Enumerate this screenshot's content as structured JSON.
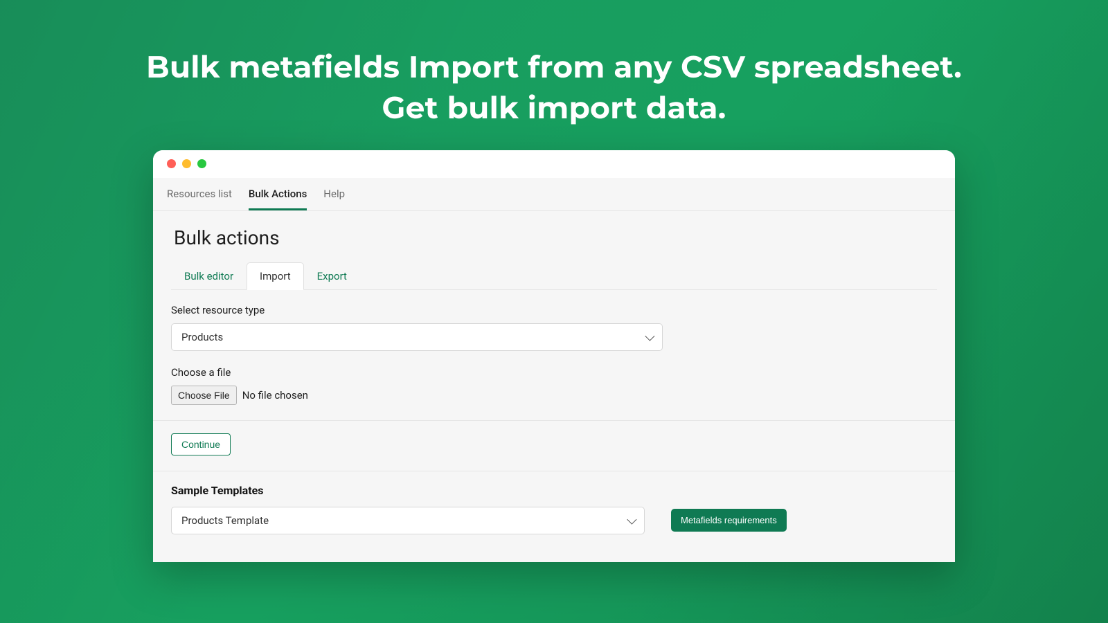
{
  "hero": {
    "line1": "Bulk metafields Import from any CSV spreadsheet.",
    "line2": "Get bulk import data."
  },
  "nav": {
    "items": [
      {
        "label": "Resources list",
        "active": false
      },
      {
        "label": "Bulk Actions",
        "active": true
      },
      {
        "label": "Help",
        "active": false
      }
    ]
  },
  "page": {
    "title": "Bulk actions"
  },
  "subtabs": [
    {
      "label": "Bulk editor",
      "active": false
    },
    {
      "label": "Import",
      "active": true
    },
    {
      "label": "Export",
      "active": false
    }
  ],
  "form": {
    "resource_label": "Select resource type",
    "resource_value": "Products",
    "file_label": "Choose a file",
    "choose_file_button": "Choose File",
    "file_status": "No file chosen",
    "continue_button": "Continue"
  },
  "templates": {
    "heading": "Sample Templates",
    "select_value": "Products Template",
    "requirements_button": "Metafields requirements"
  },
  "colors": {
    "brand_green": "#0f7a53",
    "bg_green": "#1a9960"
  }
}
